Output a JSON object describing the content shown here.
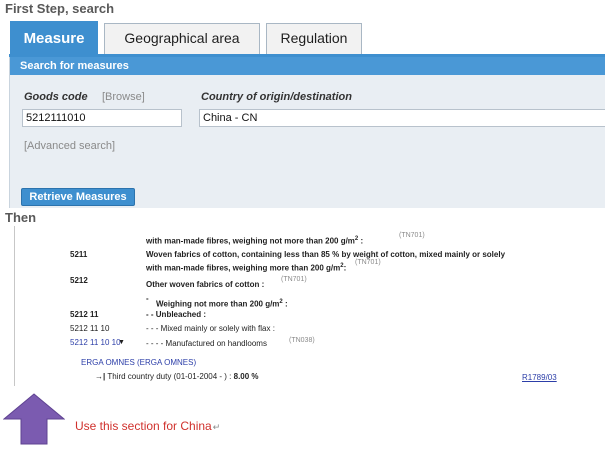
{
  "headings": {
    "first_step": "First Step, search",
    "then": "Then"
  },
  "tabs": [
    {
      "label": "Measure",
      "active": true
    },
    {
      "label": "Geographical area",
      "active": false
    },
    {
      "label": "Regulation",
      "active": false
    }
  ],
  "search": {
    "header": "Search for measures",
    "goods_code_label": "Goods code",
    "browse_label": "[Browse]",
    "goods_code_value": "5212111010",
    "country_label": "Country of origin/destination",
    "country_value": "China - CN",
    "advanced_search_label": "[Advanced search]",
    "retrieve_label": "Retrieve Measures"
  },
  "tariff": {
    "row0": {
      "desc": "with man-made fibres, weighing not more than 200 g/m",
      "sup": "2",
      "tail": " :",
      "ref": "(TN701)"
    },
    "row1": {
      "code": "5211",
      "desc_line1": "Woven fabrics of cotton, containing less than 85 % by weight of cotton, mixed mainly or solely",
      "desc_line2": "with man-made fibres, weighing more than 200 g/m",
      "sup": "2",
      "tail": ":",
      "ref": "(TN701)"
    },
    "row2": {
      "code": "5212",
      "desc": "Other woven fabrics of cotton :",
      "ref": "(TN701)"
    },
    "row3": {
      "prefix": "-",
      "desc": "Weighing not more than 200 g/m",
      "sup": "2",
      "tail": " :"
    },
    "row4": {
      "code": "5212 11",
      "desc": "- - Unbleached :"
    },
    "row5": {
      "code": "5212 11 10",
      "desc": "- - - Mixed mainly or solely with flax :"
    },
    "row6": {
      "code": "5212 11 10 10",
      "marker": "▼",
      "desc": "- - - - Manufactured on handlooms",
      "ref": "(TN038)"
    },
    "measure_group": "ERGA OMNES (ERGA OMNES)",
    "duty_label": "Third country duty (01-01-2004 - ) :",
    "duty_value": "8.00 %",
    "regulation_ref": "R1789/03"
  },
  "note": {
    "text": "Use this section for China",
    "return_glyph": "↵"
  },
  "colors": {
    "tab_active": "#3e8fcf",
    "form_header": "#4a98d6",
    "form_bg": "#e9eef3",
    "note_text": "#d0312d",
    "arrow_fill": "#7b5bb0",
    "link": "#2c3ea8"
  }
}
